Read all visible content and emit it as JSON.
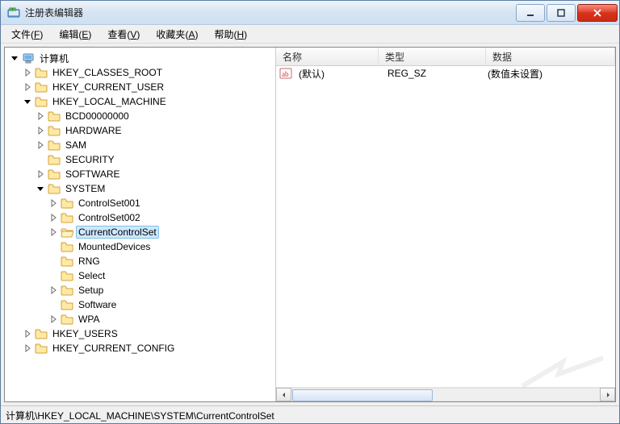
{
  "window": {
    "title": "注册表编辑器"
  },
  "menu": {
    "file": {
      "label": "文件",
      "hotkey": "F"
    },
    "edit": {
      "label": "编辑",
      "hotkey": "E"
    },
    "view": {
      "label": "查看",
      "hotkey": "V"
    },
    "favorites": {
      "label": "收藏夹",
      "hotkey": "A"
    },
    "help": {
      "label": "帮助",
      "hotkey": "H"
    }
  },
  "tree": {
    "root": "计算机",
    "hkcr": "HKEY_CLASSES_ROOT",
    "hkcu": "HKEY_CURRENT_USER",
    "hklm": "HKEY_LOCAL_MACHINE",
    "hklm_children": {
      "bcd": "BCD00000000",
      "hardware": "HARDWARE",
      "sam": "SAM",
      "security": "SECURITY",
      "software": "SOFTWARE",
      "system": "SYSTEM"
    },
    "system_children": {
      "cs1": "ControlSet001",
      "cs2": "ControlSet002",
      "ccs": "CurrentControlSet",
      "mounted": "MountedDevices",
      "rng": "RNG",
      "select": "Select",
      "setup": "Setup",
      "software": "Software",
      "wpa": "WPA"
    },
    "hku": "HKEY_USERS",
    "hkcc": "HKEY_CURRENT_CONFIG"
  },
  "list": {
    "columns": {
      "name": "名称",
      "type": "类型",
      "data": "数据"
    },
    "rows": [
      {
        "name": "(默认)",
        "type": "REG_SZ",
        "data": "(数值未设置)"
      }
    ]
  },
  "status": {
    "path": "计算机\\HKEY_LOCAL_MACHINE\\SYSTEM\\CurrentControlSet"
  },
  "icons": {
    "computer": "computer-icon",
    "folder": "folder-icon",
    "folder_open": "folder-open-icon",
    "string_value": "string-value-icon"
  },
  "colors": {
    "selection_bg": "#cde8ff",
    "selection_border": "#7fbfe5",
    "folder_fill": "#ffe9a5",
    "folder_stroke": "#d2a33a",
    "close_btn": "#d7321a"
  }
}
